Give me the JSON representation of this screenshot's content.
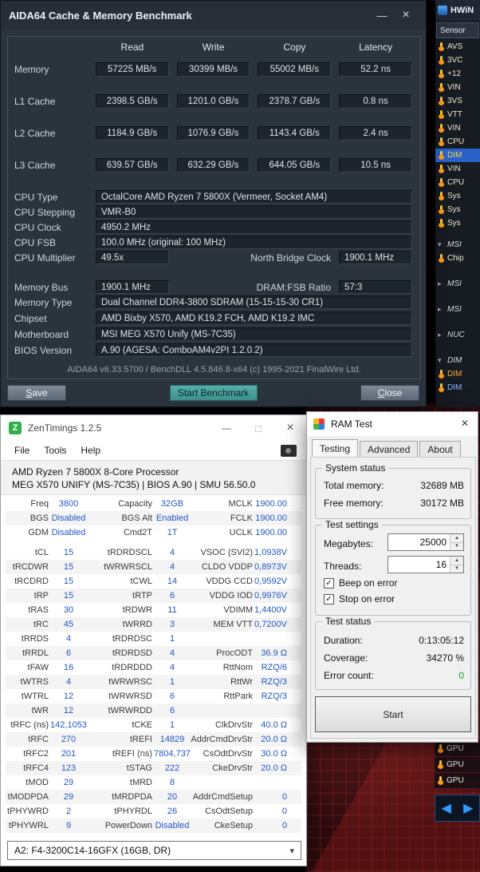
{
  "colors": {
    "zen_value_blue": "#2456c4",
    "error_count_green": "#149e2c",
    "start_benchmark_teal": "#4aa3a0",
    "selected_sensor_bg": "#2a62c8",
    "sensor_icon_yellow": "#ffc83d",
    "nav_arrow_blue": "#2f9dff"
  },
  "aida64": {
    "title": "AIDA64 Cache & Memory Benchmark",
    "bench": {
      "columns": [
        "Read",
        "Write",
        "Copy",
        "Latency"
      ],
      "rows": [
        {
          "label": "Memory",
          "read": "57225 MB/s",
          "write": "30399 MB/s",
          "copy": "55002 MB/s",
          "latency": "52.2 ns"
        },
        {
          "label": "L1 Cache",
          "read": "2398.5 GB/s",
          "write": "1201.0 GB/s",
          "copy": "2378.7 GB/s",
          "latency": "0.8 ns"
        },
        {
          "label": "L2 Cache",
          "read": "1184.9 GB/s",
          "write": "1076.9 GB/s",
          "copy": "1143.4 GB/s",
          "latency": "2.4 ns"
        },
        {
          "label": "L3 Cache",
          "read": "639.57 GB/s",
          "write": "632.29 GB/s",
          "copy": "644.05 GB/s",
          "latency": "10.5 ns"
        }
      ]
    },
    "info_top": [
      {
        "label": "CPU Type",
        "value": "OctalCore AMD Ryzen 7 5800X  (Vermeer, Socket AM4)"
      },
      {
        "label": "CPU Stepping",
        "value": "VMR-B0"
      },
      {
        "label": "CPU Clock",
        "value": "4950.2 MHz"
      },
      {
        "label": "CPU FSB",
        "value": "100.0 MHz  (original: 100 MHz)"
      }
    ],
    "split_rows": [
      {
        "label": "CPU Multiplier",
        "value": "49.5x",
        "label2": "North Bridge Clock",
        "value2": "1900.1 MHz"
      },
      {
        "label": "Memory Bus",
        "value": "1900.1 MHz",
        "label2": "DRAM:FSB Ratio",
        "value2": "57:3"
      }
    ],
    "info_bottom": [
      {
        "label": "Memory Type",
        "value": "Dual Channel DDR4-3800 SDRAM  (15-15-15-30 CR1)"
      },
      {
        "label": "Chipset",
        "value": "AMD Bixby X570, AMD K19.2 FCH, AMD K19.2 IMC"
      },
      {
        "label": "Motherboard",
        "value": "MSI MEG X570 Unify (MS-7C35)"
      },
      {
        "label": "BIOS Version",
        "value": "A.90  (AGESA: ComboAM4v2PI 1.2.0.2)"
      }
    ],
    "footer": "AIDA64 v6.33.5700 / BenchDLL 4.5.846.8-x64  (c) 1995-2021 FinalWire Ltd.",
    "buttons": {
      "save": "Save",
      "start": "Start Benchmark",
      "close": "Close"
    }
  },
  "zentimings": {
    "icon_letter": "Z",
    "title": "ZenTimings 1.2.5",
    "menu": [
      "File",
      "Tools",
      "Help"
    ],
    "header_line1": "AMD Ryzen 7 5800X 8-Core Processor",
    "header_line2": "MEG X570 UNIFY (MS-7C35) | BIOS A.90 | SMU 56.50.0",
    "top_rows": [
      {
        "l1": "Freq",
        "v1": "3800",
        "l2": "Capacity",
        "v2": "32GB",
        "l3": "MCLK",
        "v3": "1900.00"
      },
      {
        "l1": "BGS",
        "v1": "Disabled",
        "l2": "BGS Alt",
        "v2": "Enabled",
        "l3": "FCLK",
        "v3": "1900.00"
      },
      {
        "l1": "GDM",
        "v1": "Disabled",
        "l2": "Cmd2T",
        "v2": "1T",
        "l3": "UCLK",
        "v3": "1900.00"
      }
    ],
    "rows": [
      {
        "l1": "tCL",
        "v1": "15",
        "l2": "tRDRDSCL",
        "v2": "4",
        "l3": "VSOC (SVI2)",
        "v3": "1,0938V"
      },
      {
        "l1": "tRCDWR",
        "v1": "15",
        "l2": "tWRWRSCL",
        "v2": "4",
        "l3": "CLDO VDDP",
        "v3": "0,8973V"
      },
      {
        "l1": "tRCDRD",
        "v1": "15",
        "l2": "tCWL",
        "v2": "14",
        "l3": "VDDG CCD",
        "v3": "0,9592V"
      },
      {
        "l1": "tRP",
        "v1": "15",
        "l2": "tRTP",
        "v2": "6",
        "l3": "VDDG IOD",
        "v3": "0,9976V"
      },
      {
        "l1": "tRAS",
        "v1": "30",
        "l2": "tRDWR",
        "v2": "11",
        "l3": "VDIMM",
        "v3": "1,4400V"
      },
      {
        "l1": "tRC",
        "v1": "45",
        "l2": "tWRRD",
        "v2": "3",
        "l3": "MEM VTT",
        "v3": "0,7200V"
      },
      {
        "l1": "tRRDS",
        "v1": "4",
        "l2": "tRDRDSC",
        "v2": "1",
        "l3": "",
        "v3": ""
      },
      {
        "l1": "tRRDL",
        "v1": "6",
        "l2": "tRDRDSD",
        "v2": "4",
        "l3": "ProcODT",
        "v3": "36.9 Ω"
      },
      {
        "l1": "tFAW",
        "v1": "16",
        "l2": "tRDRDDD",
        "v2": "4",
        "l3": "RttNom",
        "v3": "RZQ/6"
      },
      {
        "l1": "tWTRS",
        "v1": "4",
        "l2": "tWRWRSC",
        "v2": "1",
        "l3": "RttWr",
        "v3": "RZQ/3"
      },
      {
        "l1": "tWTRL",
        "v1": "12",
        "l2": "tWRWRSD",
        "v2": "6",
        "l3": "RttPark",
        "v3": "RZQ/3"
      },
      {
        "l1": "tWR",
        "v1": "12",
        "l2": "tWRWRDD",
        "v2": "6",
        "l3": "",
        "v3": ""
      },
      {
        "l1": "tRFC (ns)",
        "v1": "142,1053",
        "l2": "tCKE",
        "v2": "1",
        "l3": "ClkDrvStr",
        "v3": "40.0 Ω"
      },
      {
        "l1": "tRFC",
        "v1": "270",
        "l2": "tREFI",
        "v2": "14829",
        "l3": "AddrCmdDrvStr",
        "v3": "20.0 Ω"
      },
      {
        "l1": "tRFC2",
        "v1": "201",
        "l2": "tREFI (ns)",
        "v2": "7804,737",
        "l3": "CsOdtDrvStr",
        "v3": "30.0 Ω"
      },
      {
        "l1": "tRFC4",
        "v1": "123",
        "l2": "tSTAG",
        "v2": "222",
        "l3": "CkeDrvStr",
        "v3": "20.0 Ω"
      },
      {
        "l1": "tMOD",
        "v1": "29",
        "l2": "tMRD",
        "v2": "8",
        "l3": "",
        "v3": ""
      },
      {
        "l1": "tMODPDA",
        "v1": "29",
        "l2": "tMRDPDA",
        "v2": "20",
        "l3": "AddrCmdSetup",
        "v3": "0"
      },
      {
        "l1": "tPHYWRD",
        "v1": "2",
        "l2": "tPHYRDL",
        "v2": "26",
        "l3": "CsOdtSetup",
        "v3": "0"
      },
      {
        "l1": "tPHYWRL",
        "v1": "9",
        "l2": "PowerDown",
        "v2": "Disabled",
        "l3": "CkeSetup",
        "v3": "0"
      }
    ],
    "dimm_selector": "A2: F4-3200C14-16GFX (16GB, DR)"
  },
  "ramtest": {
    "title": "RAM Test",
    "tabs": [
      {
        "label": "Testing",
        "v": "active"
      },
      {
        "label": "Advanced",
        "v": ""
      },
      {
        "label": "About",
        "v": ""
      }
    ],
    "system_status": {
      "title": "System status",
      "total_label": "Total memory:",
      "total_value": "32689 MB",
      "free_label": "Free memory:",
      "free_value": "30172 MB"
    },
    "test_settings": {
      "title": "Test settings",
      "megabytes_label": "Megabytes:",
      "megabytes_value": "25000",
      "threads_label": "Threads:",
      "threads_value": "16",
      "beep_label": "Beep on error",
      "stop_label": "Stop on error"
    },
    "test_status": {
      "title": "Test status",
      "duration_label": "Duration:",
      "duration_value": "0:13:05:12",
      "coverage_label": "Coverage:",
      "coverage_value": "34270 %",
      "errors_label": "Error count:",
      "errors_value": "0"
    },
    "start_button": "Start"
  },
  "hwinfo": {
    "title": "HWiN",
    "section": "Sensor",
    "top": [
      {
        "label": "AVS",
        "ic": "t",
        "v": ""
      },
      {
        "label": "3VC",
        "ic": "t",
        "v": ""
      },
      {
        "label": "+12",
        "ic": "t",
        "v": ""
      },
      {
        "label": "VIN",
        "ic": "t",
        "v": ""
      },
      {
        "label": "3VS",
        "ic": "t",
        "v": ""
      },
      {
        "label": "VTT",
        "ic": "t",
        "v": ""
      },
      {
        "label": "VIN",
        "ic": "t",
        "v": ""
      },
      {
        "label": "CPU",
        "ic": "t",
        "v": ""
      },
      {
        "label": "DIM",
        "ic": "t",
        "v": "sel"
      },
      {
        "label": "VIN",
        "ic": "t",
        "v": ""
      },
      {
        "label": "CPU",
        "ic": "t",
        "v": ""
      },
      {
        "label": "Sys",
        "ic": "t",
        "v": ""
      },
      {
        "label": "Sys",
        "ic": "t",
        "v": ""
      },
      {
        "label": "Sys",
        "ic": "t",
        "v": ""
      }
    ],
    "tree": [
      {
        "label": "MSI",
        "ic": "d",
        "v": "hdr",
        "g": ""
      },
      {
        "label": "Chip",
        "ic": "t",
        "v": "",
        "g": ""
      },
      {
        "label": "MSI",
        "ic": "r",
        "v": "hdr",
        "g": "1"
      },
      {
        "label": "MSI",
        "ic": "r",
        "v": "hdr",
        "g": "1"
      },
      {
        "label": "NUC",
        "ic": "r",
        "v": "hdr",
        "g": "1"
      },
      {
        "label": "DIM",
        "ic": "d",
        "v": "hdr",
        "g": "1"
      },
      {
        "label": "DIM",
        "ic": "t",
        "v": "o",
        "g": ""
      },
      {
        "label": "DIM",
        "ic": "t",
        "v": "b",
        "g": ""
      }
    ],
    "gpu": [
      "GPU",
      "GPU",
      "GPU"
    ]
  }
}
